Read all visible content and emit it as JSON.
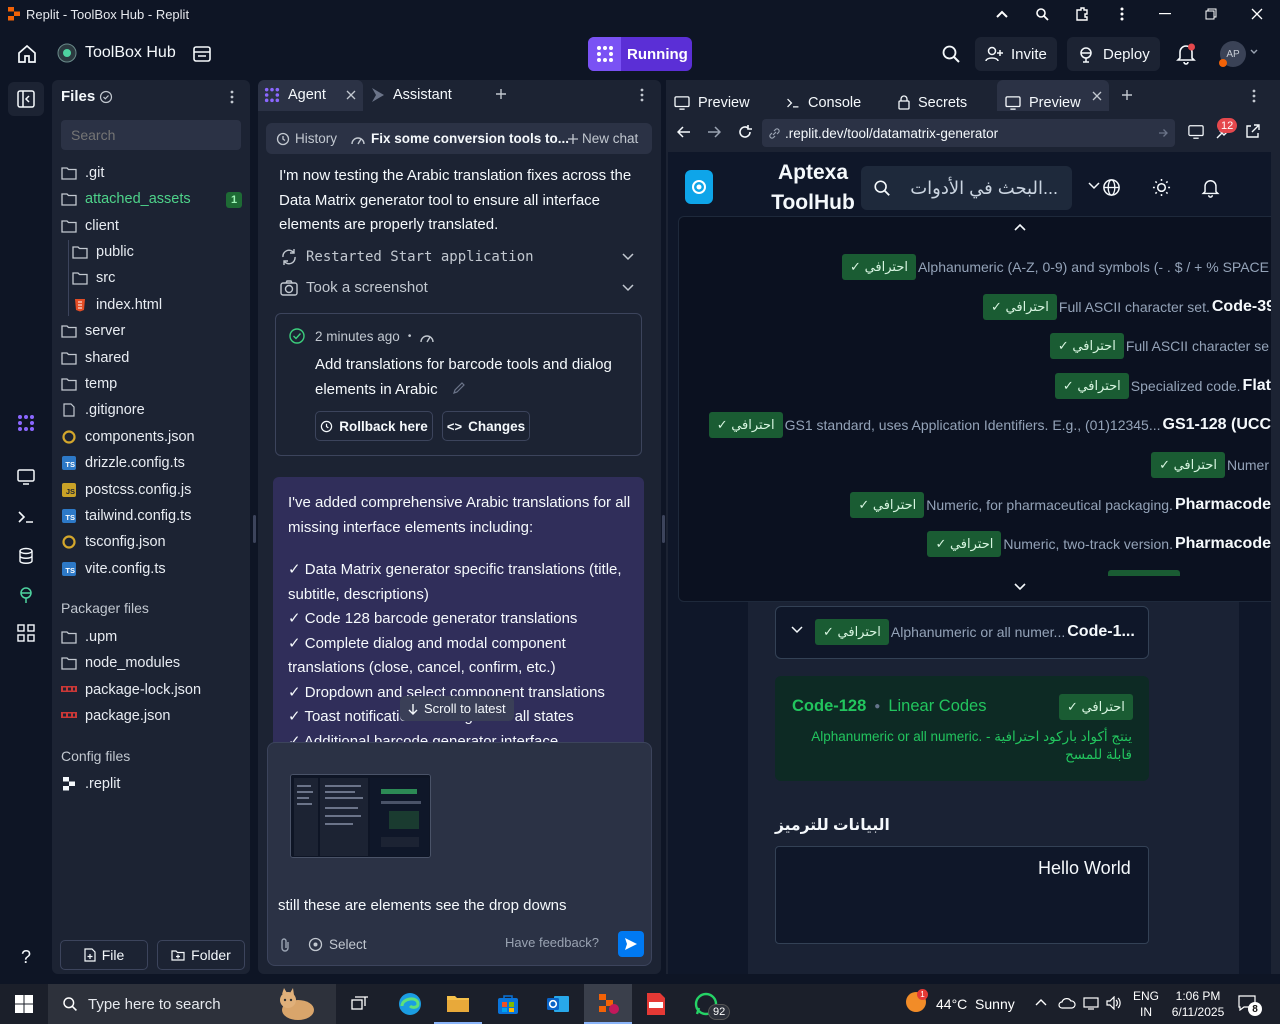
{
  "window": {
    "title": "Replit - ToolBox Hub - Replit"
  },
  "header": {
    "project_name": "ToolBox Hub",
    "run_status": "Running",
    "invite_label": "Invite",
    "deploy_label": "Deploy",
    "avatar_initials": "AP"
  },
  "files_panel": {
    "title": "Files",
    "search_placeholder": "Search",
    "items": [
      {
        "label": ".git",
        "type": "folder"
      },
      {
        "label": "attached_assets",
        "type": "folder",
        "badge": "1"
      },
      {
        "label": "client",
        "type": "folder"
      },
      {
        "label": "public",
        "type": "folder"
      },
      {
        "label": "src",
        "type": "folder"
      },
      {
        "label": "index.html",
        "type": "html"
      },
      {
        "label": "server",
        "type": "folder"
      },
      {
        "label": "shared",
        "type": "folder"
      },
      {
        "label": "temp",
        "type": "folder"
      },
      {
        "label": ".gitignore",
        "type": "file"
      },
      {
        "label": "components.json",
        "type": "json"
      },
      {
        "label": "drizzle.config.ts",
        "type": "ts"
      },
      {
        "label": "postcss.config.js",
        "type": "js"
      },
      {
        "label": "tailwind.config.ts",
        "type": "ts"
      },
      {
        "label": "tsconfig.json",
        "type": "json"
      },
      {
        "label": "vite.config.ts",
        "type": "ts"
      }
    ],
    "packager_title": "Packager files",
    "packager_items": [
      {
        "label": ".upm",
        "type": "folder"
      },
      {
        "label": "node_modules",
        "type": "folder"
      },
      {
        "label": "package-lock.json",
        "type": "npm"
      },
      {
        "label": "package.json",
        "type": "npm"
      }
    ],
    "config_title": "Config files",
    "config_items": [
      {
        "label": ".replit",
        "type": "replit"
      }
    ],
    "new_file_label": "File",
    "new_folder_label": "Folder"
  },
  "agent_panel": {
    "tabs": [
      {
        "label": "Agent"
      },
      {
        "label": "Assistant"
      }
    ],
    "history_label": "History",
    "thread_title": "Fix some conversion tools to...",
    "new_chat_label": "New chat",
    "message1": "I'm now testing the Arabic translation fixes across the Data Matrix generator tool to ensure all interface elements are properly translated.",
    "action1": "Restarted Start application",
    "action2": "Took a screenshot",
    "checkpoint": {
      "time": "2 minutes ago",
      "text": "Add translations for barcode tools and dialog elements in Arabic",
      "rollback_label": "Rollback here",
      "changes_label": "Changes"
    },
    "message2_intro": "I've added comprehensive Arabic translations for all missing interface elements including:",
    "message2_items": [
      "✓ Data Matrix generator specific translations (title, subtitle, descriptions)",
      "✓ Code 128 barcode generator translations",
      "✓ Complete dialog and modal component translations (close, cancel, confirm, etc.)",
      "✓ Dropdown and select component translations",
      "✓ Toast notification messages for all states",
      "✓ Additional barcode generator interface"
    ],
    "scroll_latest_label": "Scroll to latest",
    "input_text": "still these are elements see the drop downs",
    "select_label": "Select",
    "feedback_label": "Have feedback?"
  },
  "preview_panel": {
    "tabs": [
      {
        "label": "Preview"
      },
      {
        "label": "Console"
      },
      {
        "label": "Secrets"
      },
      {
        "label": "Preview"
      }
    ],
    "url": ".replit.dev/tool/datamatrix-generator",
    "notification_count": "12",
    "site": {
      "brand_line1": "Aptexa",
      "brand_line2": "ToolHub",
      "search_placeholder": "البحث في الأدوات...",
      "pro_badge": "✓ احترافي",
      "dropdown_rows": [
        {
          "desc": "Alphanumeric (A-Z, 0-9) and symbols (- . $ / + % SPACE",
          "name": ""
        },
        {
          "desc": "Full ASCII character set.",
          "name": "Code-39"
        },
        {
          "desc": "Full ASCII character se",
          "name": ""
        },
        {
          "desc": "Specialized code.",
          "name": "Flat"
        },
        {
          "desc": "GS1 standard, uses Application Identifiers. E.g., (01)12345...",
          "name": "GS1-128 (UCC"
        },
        {
          "desc": "Numer",
          "name": ""
        },
        {
          "desc": "Numeric, for pharmaceutical packaging.",
          "name": "Pharmacode"
        },
        {
          "desc": "Numeric, two-track version.",
          "name": "Pharmacode"
        }
      ],
      "select_desc": "Alphanumeric or all numer...",
      "select_name": "Code-1...",
      "info_title": "Code-128",
      "info_category": "Linear Codes",
      "info_desc_line1": "Alphanumeric or all numeric. - ينتج أكواد باركود احترافية",
      "info_desc_line2": "قابلة للمسح",
      "data_label": "البيانات للترميز",
      "data_value": "Hello World"
    }
  },
  "taskbar": {
    "search_placeholder": "Type here to search",
    "weather": "44°C  Sunny",
    "lang1": "ENG",
    "lang2": "IN",
    "time": "1:06 PM",
    "date": "6/11/2025",
    "whatsapp_badge": "92",
    "notif_count": "8",
    "weather_badge": "1"
  },
  "colors": {
    "bg": "#0e1525",
    "panel": "#1c2333",
    "accent_purple": "#5b2fd6",
    "pro_green": "#1a5c33",
    "info_green": "#22c55e"
  }
}
